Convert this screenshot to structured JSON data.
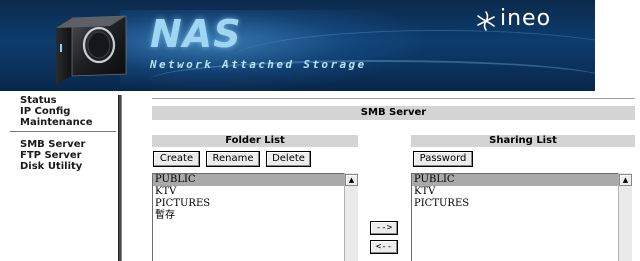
{
  "banner": {
    "title": "NAS",
    "subtitle": "Network Attached Storage",
    "brand": "ineo",
    "brand_logo_icon": "snowflake-icon",
    "device_icon": "hard-drive-enclosure-icon",
    "colors": {
      "background": "#0d3c6e",
      "title": "#9fd6f3",
      "brand": "#ffffff"
    }
  },
  "sidebar": {
    "group1": [
      {
        "label": "Status"
      },
      {
        "label": "IP Config"
      },
      {
        "label": "Maintenance"
      }
    ],
    "group2": [
      {
        "label": "SMB Server"
      },
      {
        "label": "FTP Server"
      },
      {
        "label": "Disk Utility"
      }
    ]
  },
  "main": {
    "section_title": "SMB Server",
    "folder_panel": {
      "title": "Folder List",
      "buttons": {
        "create": "Create",
        "rename": "Rename",
        "delete": "Delete"
      },
      "items": [
        "PUBLIC",
        "KTV",
        "PICTURES",
        "暫存"
      ],
      "selected": "PUBLIC"
    },
    "sharing_panel": {
      "title": "Sharing List",
      "buttons": {
        "password": "Password"
      },
      "items": [
        "PUBLIC",
        "KTV",
        "PICTURES"
      ],
      "selected": "PUBLIC"
    },
    "transfer": {
      "add": "-->",
      "remove": "<--"
    },
    "colors": {
      "header_bg": "#d4d4d4",
      "selected_bg": "#a9a9a9"
    }
  }
}
